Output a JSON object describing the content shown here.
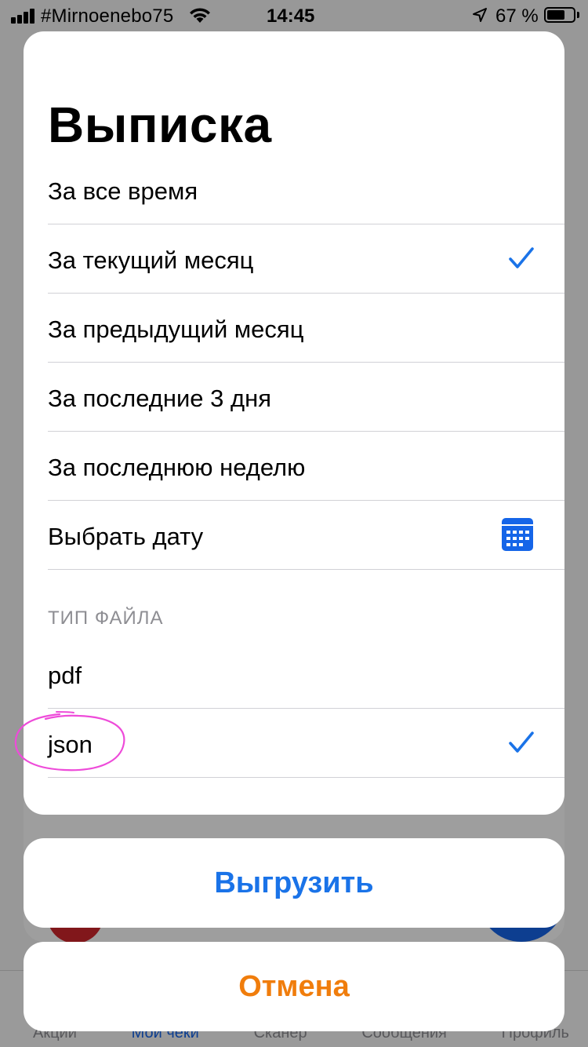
{
  "status_bar": {
    "carrier": "#Mirnoenebo75",
    "time": "14:45",
    "battery_percent": "67 %"
  },
  "sheet": {
    "title": "Выписка",
    "period_options": [
      {
        "label": "За все время",
        "selected": false
      },
      {
        "label": "За текущий месяц",
        "selected": true
      },
      {
        "label": "За предыдущий месяц",
        "selected": false
      },
      {
        "label": "За последние 3 дня",
        "selected": false
      },
      {
        "label": "За последнюю неделю",
        "selected": false
      },
      {
        "label": "Выбрать дату",
        "selected": false
      }
    ],
    "file_type_header": "ТИП ФАЙЛА",
    "file_types": [
      {
        "label": "pdf",
        "selected": false
      },
      {
        "label": "json",
        "selected": true
      }
    ]
  },
  "buttons": {
    "export_label": "Выгрузить",
    "cancel_label": "Отмена"
  },
  "background_tabs": {
    "tab1": "Акции",
    "tab2": "Мои чеки",
    "tab3": "Сканер",
    "tab4": "Сообщения",
    "tab5": "Профиль"
  },
  "colors": {
    "accent_blue": "#1a73e8",
    "cancel_orange": "#f07d0c",
    "annotation_magenta": "#ee4bd9",
    "calendar_blue": "#1565e8"
  },
  "icons": {
    "selected_indicator": "checkmark-icon",
    "date_picker": "calendar-icon"
  }
}
